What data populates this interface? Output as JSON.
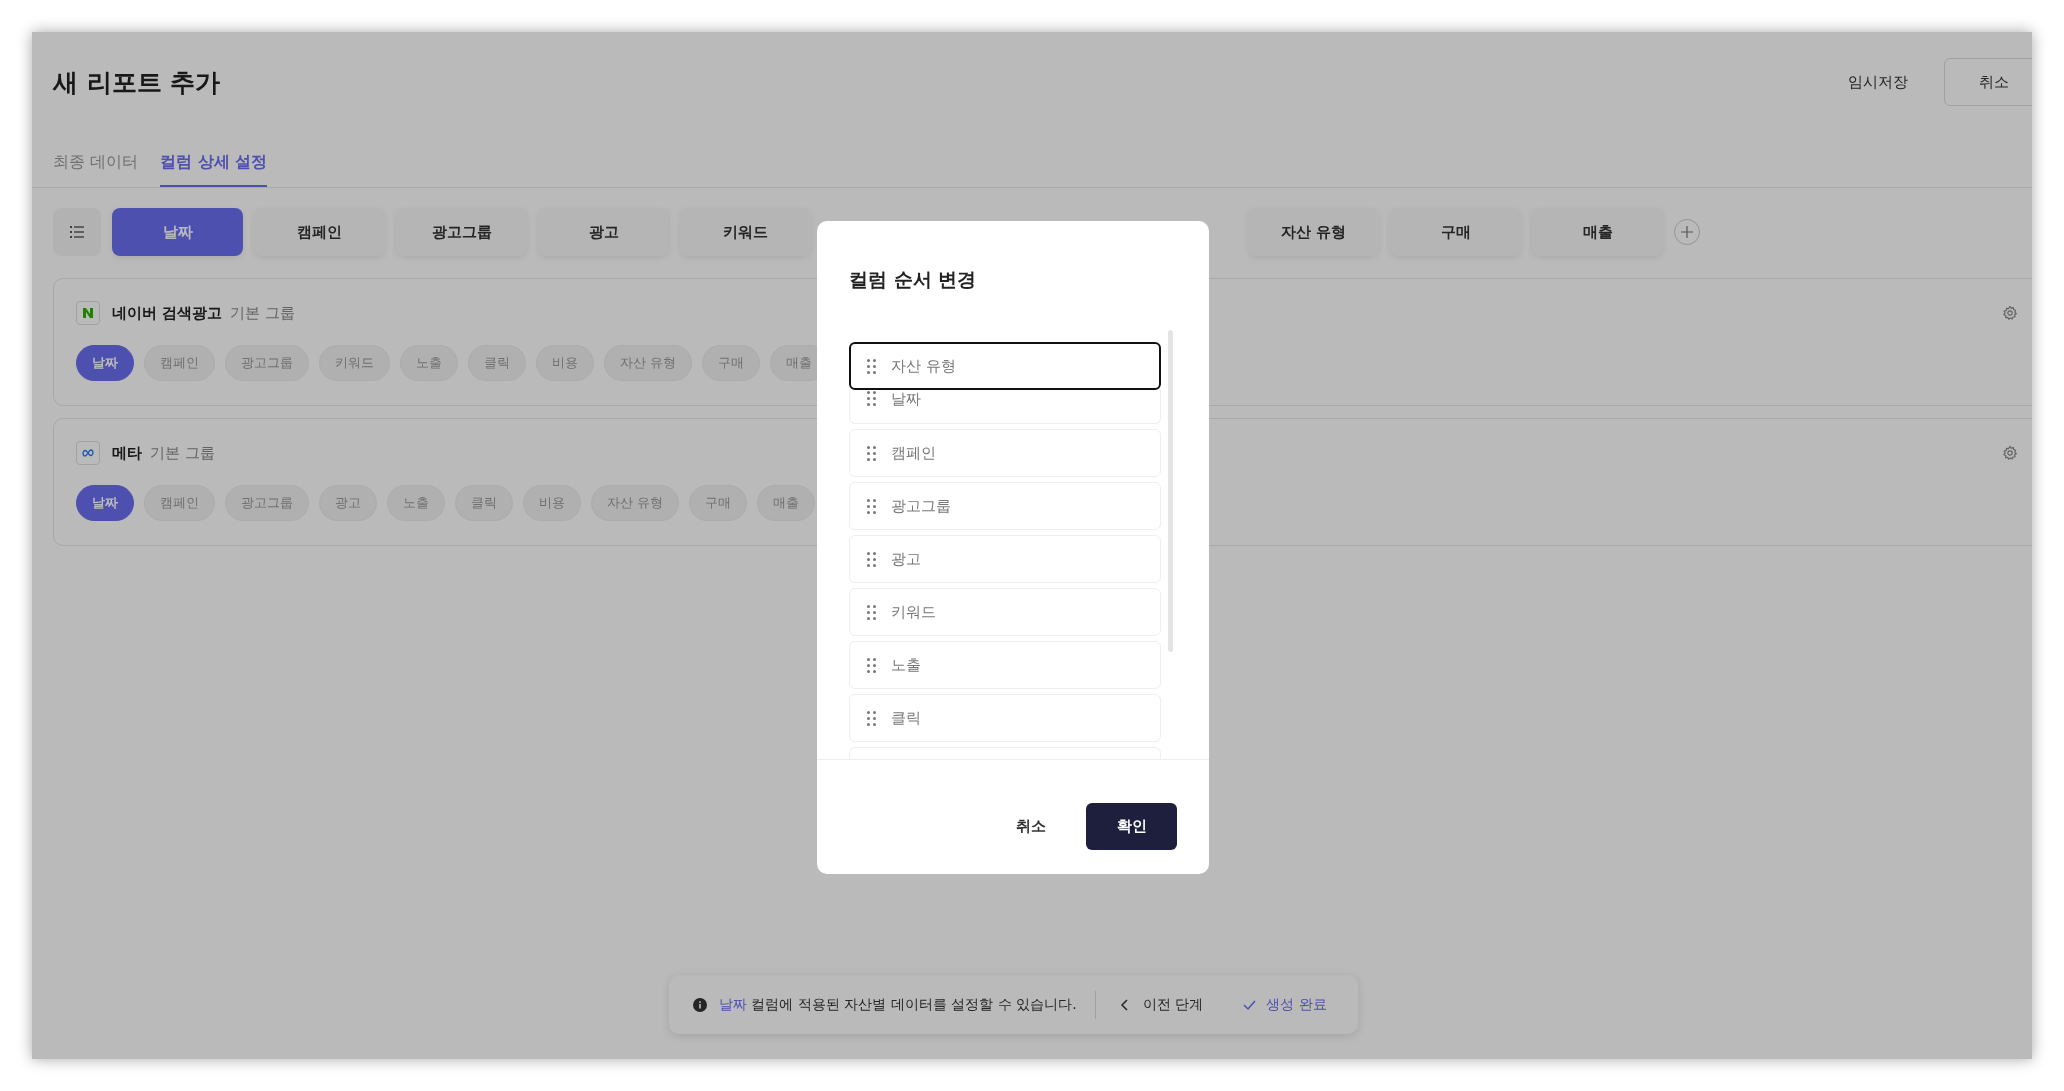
{
  "window": {
    "title": "새 리포트 추가",
    "actions": [
      {
        "label": "임시저장",
        "kind": "text"
      },
      {
        "label": "취소",
        "kind": "outline"
      }
    ]
  },
  "tabs": [
    {
      "label": "최종 데이터",
      "selected": false
    },
    {
      "label": "컬럼 상세 설정",
      "selected": true
    }
  ],
  "column_chips": [
    {
      "label": "날짜",
      "selected": true
    },
    {
      "label": "캠페인",
      "selected": false
    },
    {
      "label": "광고그룹",
      "selected": false
    },
    {
      "label": "광고",
      "selected": false
    },
    {
      "label": "키워드",
      "selected": false
    },
    {
      "label": "자산 유형",
      "selected": false
    },
    {
      "label": "구매",
      "selected": false
    },
    {
      "label": "매출",
      "selected": false
    }
  ],
  "groups": [
    {
      "kind": "naver",
      "name": "네이버 검색광고",
      "subtitle": "기본 그룹",
      "chips": [
        {
          "label": "날짜",
          "selected": true
        },
        {
          "label": "캠페인",
          "selected": false
        },
        {
          "label": "광고그룹",
          "selected": false
        },
        {
          "label": "키워드",
          "selected": false
        },
        {
          "label": "노출",
          "selected": false
        },
        {
          "label": "클릭",
          "selected": false
        },
        {
          "label": "비용",
          "selected": false
        },
        {
          "label": "자산 유형",
          "selected": false
        },
        {
          "label": "구매",
          "selected": false
        },
        {
          "label": "매출",
          "selected": false
        }
      ]
    },
    {
      "kind": "meta",
      "name": "메타",
      "subtitle": "기본 그룹",
      "chips": [
        {
          "label": "날짜",
          "selected": true
        },
        {
          "label": "캠페인",
          "selected": false
        },
        {
          "label": "광고그룹",
          "selected": false
        },
        {
          "label": "광고",
          "selected": false
        },
        {
          "label": "노출",
          "selected": false
        },
        {
          "label": "클릭",
          "selected": false
        },
        {
          "label": "비용",
          "selected": false
        },
        {
          "label": "자산 유형",
          "selected": false
        },
        {
          "label": "구매",
          "selected": false
        },
        {
          "label": "매출",
          "selected": false
        }
      ]
    }
  ],
  "dialog": {
    "title": "컬럼 순서 변경",
    "items": [
      {
        "label": "자산 유형",
        "dragging": true
      },
      {
        "label": "날짜",
        "dragging": false
      },
      {
        "label": "캠페인",
        "dragging": false
      },
      {
        "label": "광고그룹",
        "dragging": false
      },
      {
        "label": "광고",
        "dragging": false
      },
      {
        "label": "키워드",
        "dragging": false
      },
      {
        "label": "노출",
        "dragging": false
      },
      {
        "label": "클릭",
        "dragging": false
      }
    ],
    "buttons": [
      {
        "label": "취소",
        "kind": "text"
      },
      {
        "label": "확인",
        "kind": "primary"
      }
    ]
  },
  "footer": {
    "highlight": "날짜",
    "message": " 컬럼에 적용된 자산별 데이터를 설정할 수 있습니다.",
    "actions": [
      {
        "label": "이전 단계",
        "kind": "back"
      },
      {
        "label": "생성 완료",
        "kind": "done"
      }
    ]
  }
}
